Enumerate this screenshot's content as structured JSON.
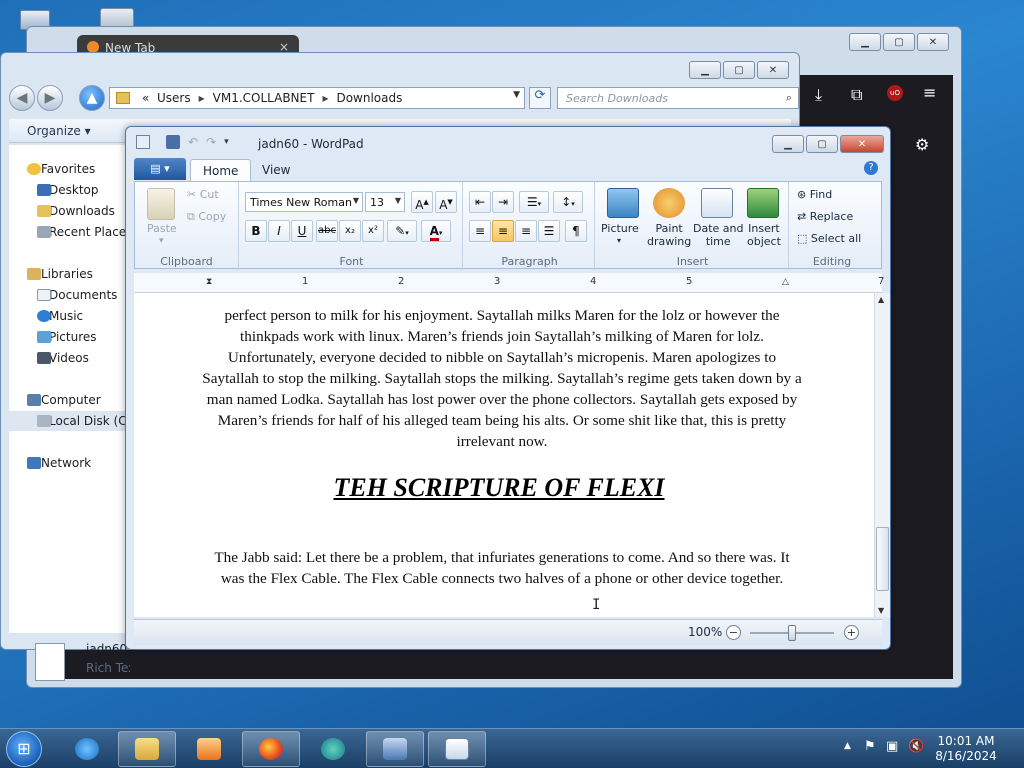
{
  "browser": {
    "tab_title": "New Tab",
    "tab_close": "×"
  },
  "explorer": {
    "breadcrumb": [
      "Users",
      "VM1.COLLABNET",
      "Downloads"
    ],
    "search_placeholder": "Search Downloads",
    "organize": "Organize",
    "nav": {
      "favorites": "Favorites",
      "desktop": "Desktop",
      "downloads": "Downloads",
      "recent": "Recent Places",
      "libraries": "Libraries",
      "documents": "Documents",
      "music": "Music",
      "pictures": "Pictures",
      "videos": "Videos",
      "computer": "Computer",
      "localdisk": "Local Disk (C:)",
      "network": "Network"
    },
    "detail_name": "jadn60",
    "detail_type": "Rich Text Document"
  },
  "wordpad": {
    "title": "jadn60 - WordPad",
    "app_menu": "▤ ▾",
    "tabs": {
      "home": "Home",
      "view": "View"
    },
    "clipboard": {
      "paste": "Paste",
      "cut": "Cut",
      "copy": "Copy",
      "label": "Clipboard"
    },
    "font": {
      "family": "Times New Roman",
      "size": "13",
      "label": "Font"
    },
    "paragraph_label": "Paragraph",
    "insert": {
      "picture": "Picture",
      "paint": "Paint\ndrawing",
      "datetime": "Date and\ntime",
      "object": "Insert\nobject",
      "label": "Insert"
    },
    "editing": {
      "find": "Find",
      "replace": "Replace",
      "selectall": "Select all",
      "label": "Editing"
    },
    "ruler_numbers": [
      "1",
      "2",
      "3",
      "4",
      "5",
      "7"
    ],
    "para1": "perfect person to milk for his enjoyment. Saytallah milks Maren for the lolz or however the thinkpads work with linux. Maren’s friends join Saytallah’s milking of Maren for lolz. Unfortunately, everyone decided to nibble on Saytallah’s micropenis. Maren apologizes to Saytallah to stop the milking. Saytallah stops the milking. Saytallah’s regime gets taken down by a man named Lodka. Saytallah has lost power over the phone collectors. Saytallah gets exposed by Maren’s friends for half of his alleged team being his alts. Or some shit like that, this is pretty irrelevant now.",
    "heading": "TEH SCRIPTURE OF FLEXI",
    "para2": "The Jabb said: Let there be a problem, that infuriates generations to come. And so there was. It was the Flex Cable. The Flex Cable connects two halves of a phone or other device together.",
    "zoom": "100%"
  },
  "taskbar": {
    "time": "10:01 AM",
    "date": "8/16/2024"
  }
}
